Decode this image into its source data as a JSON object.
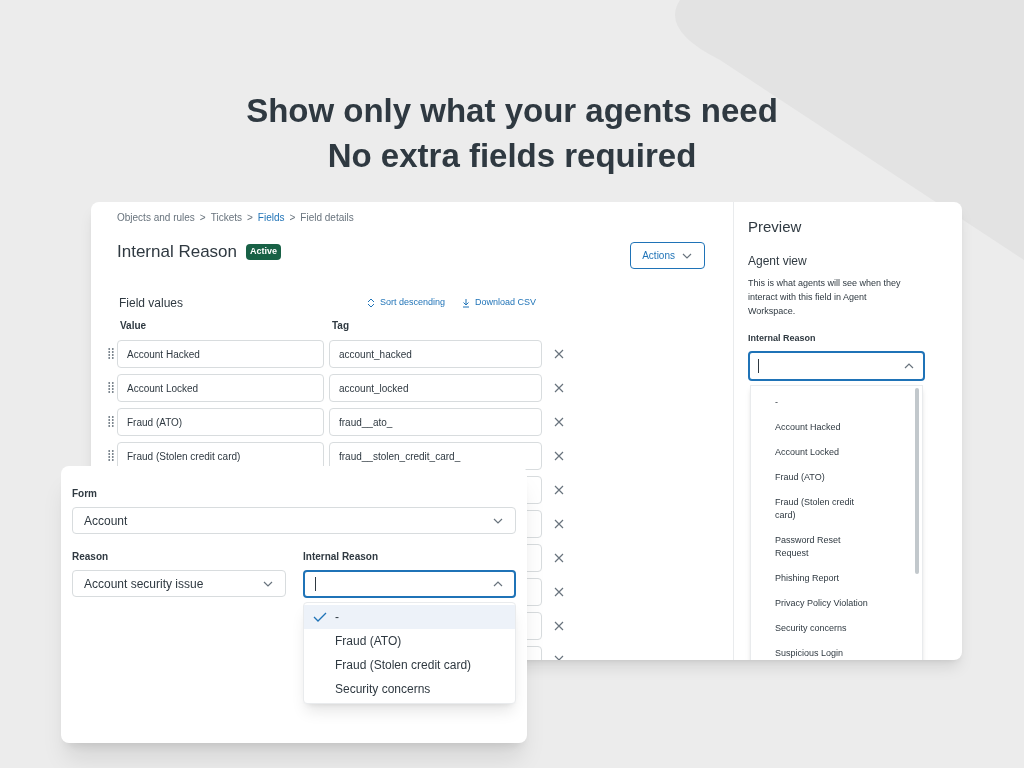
{
  "headline": [
    "Show only what your agents need",
    "No extra fields required"
  ],
  "admin": {
    "breadcrumbs": [
      {
        "label": "Objects and rules",
        "link": false
      },
      {
        "label": "Tickets",
        "link": false
      },
      {
        "label": "Fields",
        "link": true
      },
      {
        "label": "Field details",
        "link": false
      }
    ],
    "breadcrumb_separator": ">",
    "title": "Internal Reason",
    "status": "Active",
    "actions_button": "Actions",
    "section_title": "Field values",
    "sort_link": "Sort descending",
    "download_link": "Download CSV",
    "columns": [
      "Value",
      "Tag"
    ],
    "rows": [
      {
        "kind": "filled",
        "value": "Account Hacked",
        "tag": "account_hacked"
      },
      {
        "kind": "filled",
        "value": "Account Locked",
        "tag": "account_locked"
      },
      {
        "kind": "filled",
        "value": "Fraud (ATO)",
        "tag": "fraud__ato_"
      },
      {
        "kind": "filled",
        "value": "Fraud (Stolen credit card)",
        "tag": "fraud__stolen_credit_card_"
      },
      {
        "kind": "covered"
      },
      {
        "kind": "covered"
      },
      {
        "kind": "covered"
      },
      {
        "kind": "covered"
      },
      {
        "kind": "covered"
      },
      {
        "kind": "covered"
      }
    ]
  },
  "preview": {
    "title": "Preview",
    "subtitle": "Agent view",
    "description": "This is what agents will see when they interact with this field in Agent Workspace.",
    "field_label": "Internal Reason",
    "options": [
      "-",
      "Account Hacked",
      "Account Locked",
      "Fraud (ATO)",
      "Fraud (Stolen credit card)",
      "Password Reset Request",
      "Phishing Report",
      "Privacy Policy Violation",
      "Security concerns",
      "Suspicious Login"
    ]
  },
  "agent_form": {
    "form_label": "Form",
    "form_value": "Account",
    "reason_label": "Reason",
    "reason_value": "Account security issue",
    "internal_label": "Internal Reason",
    "options": [
      {
        "label": "-",
        "selected": true
      },
      {
        "label": "Fraud (ATO)",
        "selected": false
      },
      {
        "label": "Fraud (Stolen credit card)",
        "selected": false
      },
      {
        "label": "Security concerns",
        "selected": false
      }
    ]
  }
}
